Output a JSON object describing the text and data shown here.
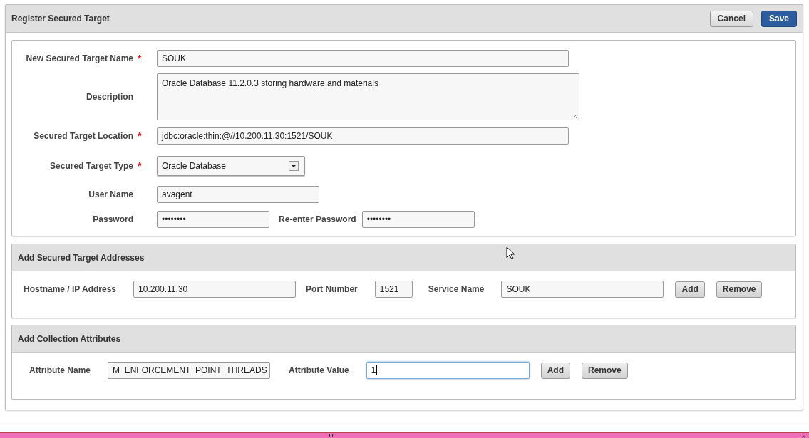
{
  "header": {
    "title": "Register Secured Target",
    "buttons": [
      {
        "label": "Cancel",
        "kind": "secondary"
      },
      {
        "label": "Save",
        "kind": "primary"
      }
    ]
  },
  "target_form": {
    "rows": [
      {
        "label": "New Secured Target Name",
        "required_mark": "*",
        "kind": "text",
        "value": "SOUK"
      },
      {
        "label": "Description",
        "kind": "textarea",
        "value": "Oracle Database 11.2.0.3 storing hardware and materials"
      },
      {
        "label": "Secured Target Location",
        "required_mark": "*",
        "kind": "text",
        "value": "jdbc:oracle:thin:@//10.200.11.30:1521/SOUK"
      },
      {
        "label": "Secured Target Type",
        "required_mark": "*",
        "kind": "select",
        "value": "Oracle Database"
      },
      {
        "label": "User Name",
        "kind": "text",
        "value": "avagent"
      },
      {
        "label": "Password",
        "kind": "password",
        "value": "••••••••",
        "extra_label": "Re-enter Password",
        "extra_value": "••••••••"
      }
    ]
  },
  "sections": [
    {
      "title": "Add Secured Target Addresses",
      "fields": [
        {
          "label": "Hostname / IP Address",
          "value": "10.200.11.30",
          "focused": false
        },
        {
          "label": "Port Number",
          "value": "1521",
          "focused": false
        },
        {
          "label": "Service Name",
          "value": "SOUK",
          "focused": false
        }
      ],
      "buttons": [
        "Add",
        "Remove"
      ]
    },
    {
      "title": "Add Collection Attributes",
      "fields": [
        {
          "label": "Attribute Name",
          "value": "M_ENFORCEMENT_POINT_THREADS",
          "focused": false
        },
        {
          "label": "Attribute Value",
          "value": "1",
          "focused": true
        }
      ],
      "buttons": [
        "Add",
        "Remove"
      ]
    }
  ]
}
